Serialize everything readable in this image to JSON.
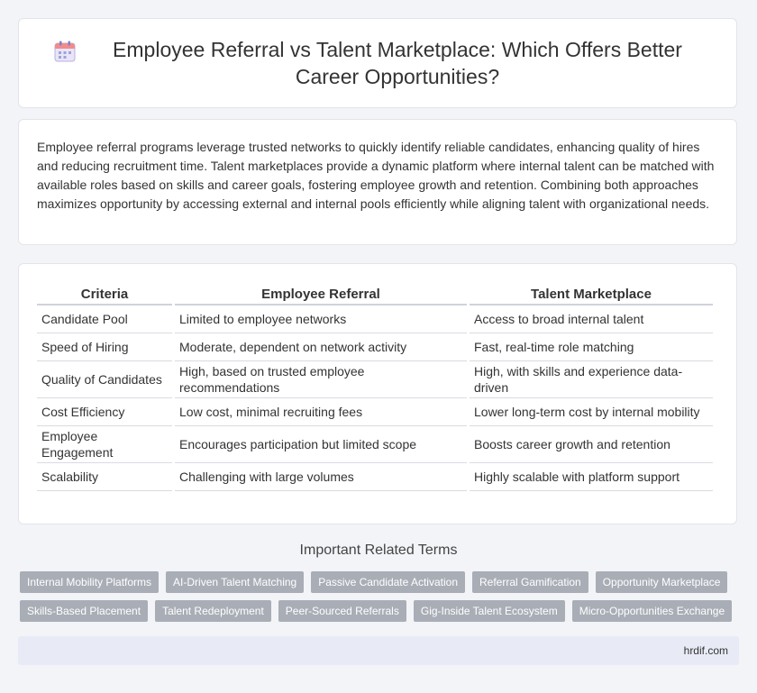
{
  "header": {
    "title": "Employee Referral vs Talent Marketplace: Which Offers Better Career Opportunities?",
    "icon": "calendar-icon"
  },
  "intro": {
    "text": "Employee referral programs leverage trusted networks to quickly identify reliable candidates, enhancing quality of hires and reducing recruitment time. Talent marketplaces provide a dynamic platform where internal talent can be matched with available roles based on skills and career goals, fostering employee growth and retention. Combining both approaches maximizes opportunity by accessing external and internal pools efficiently while aligning talent with organizational needs."
  },
  "table": {
    "headers": [
      "Criteria",
      "Employee Referral",
      "Talent Marketplace"
    ],
    "rows": [
      [
        "Candidate Pool",
        "Limited to employee networks",
        "Access to broad internal talent"
      ],
      [
        "Speed of Hiring",
        "Moderate, dependent on network activity",
        "Fast, real-time role matching"
      ],
      [
        "Quality of Candidates",
        "High, based on trusted employee recommendations",
        "High, with skills and experience data-driven"
      ],
      [
        "Cost Efficiency",
        "Low cost, minimal recruiting fees",
        "Lower long-term cost by internal mobility"
      ],
      [
        "Employee Engagement",
        "Encourages participation but limited scope",
        "Boosts career growth and retention"
      ],
      [
        "Scalability",
        "Challenging with large volumes",
        "Highly scalable with platform support"
      ]
    ]
  },
  "terms": {
    "title": "Important Related Terms",
    "row1": [
      "Internal Mobility Platforms",
      "AI-Driven Talent Matching",
      "Passive Candidate Activation",
      "Referral Gamification",
      "Opportunity Marketplace"
    ],
    "row2": [
      "Skills-Based Placement",
      "Talent Redeployment",
      "Peer-Sourced Referrals",
      "Gig-Inside Talent Ecosystem",
      "Micro-Opportunities Exchange"
    ]
  },
  "footer": {
    "site": "hrdif.com"
  },
  "colors": {
    "tag_bg": "#a9adb6",
    "footer_bg": "#e8ebf5",
    "page_bg": "#f3f4f8"
  }
}
